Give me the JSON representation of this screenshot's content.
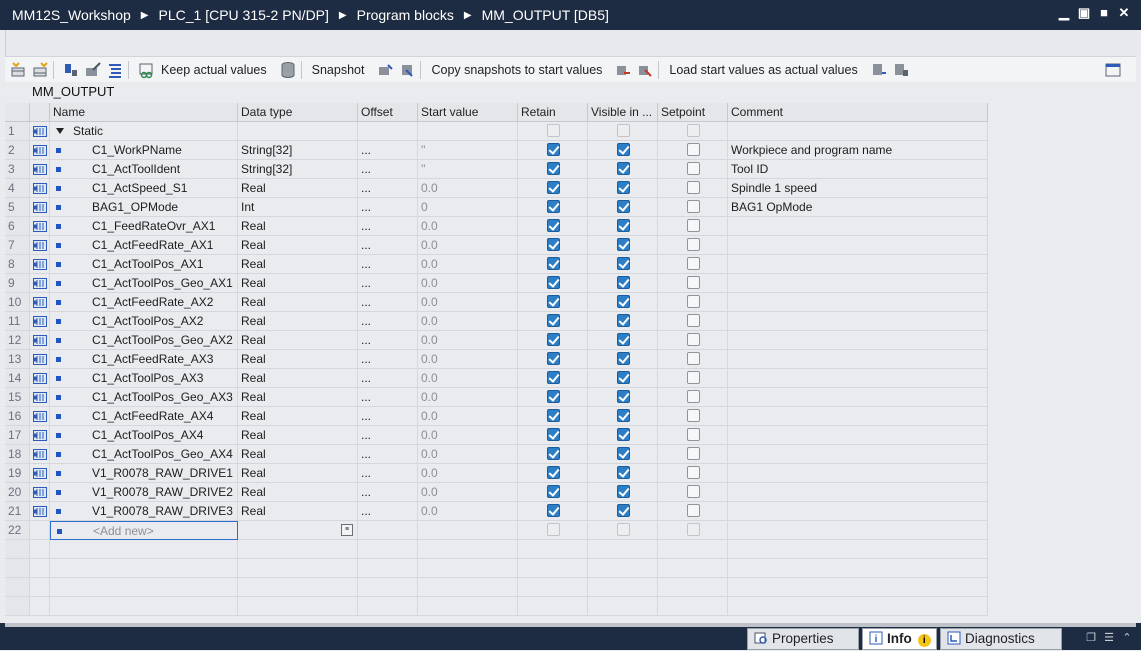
{
  "titlebar": {
    "crumbs": [
      "MM12S_Workshop",
      "PLC_1 [CPU 315-2 PN/DP]",
      "Program blocks",
      "MM_OUTPUT [DB5]"
    ]
  },
  "toolbar": {
    "keep_actual": "Keep actual values",
    "snapshot": "Snapshot",
    "copy_snapshots": "Copy snapshots to start values",
    "load_start": "Load start values as actual values"
  },
  "block": {
    "name": "MM_OUTPUT"
  },
  "columns": {
    "name": "Name",
    "data_type": "Data type",
    "offset": "Offset",
    "start_value": "Start value",
    "retain": "Retain",
    "visible": "Visible in ...",
    "setpoint": "Setpoint",
    "comment": "Comment"
  },
  "static_row": {
    "num": "1",
    "name": "Static"
  },
  "rows": [
    {
      "num": "2",
      "name": "C1_WorkPName",
      "type": "String[32]",
      "offset": "...",
      "start": "''",
      "comment": "Workpiece and program name"
    },
    {
      "num": "3",
      "name": "C1_ActToolIdent",
      "type": "String[32]",
      "offset": "...",
      "start": "''",
      "comment": "Tool ID"
    },
    {
      "num": "4",
      "name": "C1_ActSpeed_S1",
      "type": "Real",
      "offset": "...",
      "start": "0.0",
      "comment": "Spindle 1 speed"
    },
    {
      "num": "5",
      "name": "BAG1_OPMode",
      "type": "Int",
      "offset": "...",
      "start": "0",
      "comment": "BAG1 OpMode"
    },
    {
      "num": "6",
      "name": "C1_FeedRateOvr_AX1",
      "type": "Real",
      "offset": "...",
      "start": "0.0",
      "comment": ""
    },
    {
      "num": "7",
      "name": "C1_ActFeedRate_AX1",
      "type": "Real",
      "offset": "...",
      "start": "0.0",
      "comment": ""
    },
    {
      "num": "8",
      "name": "C1_ActToolPos_AX1",
      "type": "Real",
      "offset": "...",
      "start": "0.0",
      "comment": ""
    },
    {
      "num": "9",
      "name": "C1_ActToolPos_Geo_AX1",
      "type": "Real",
      "offset": "...",
      "start": "0.0",
      "comment": ""
    },
    {
      "num": "10",
      "name": "C1_ActFeedRate_AX2",
      "type": "Real",
      "offset": "...",
      "start": "0.0",
      "comment": ""
    },
    {
      "num": "11",
      "name": "C1_ActToolPos_AX2",
      "type": "Real",
      "offset": "...",
      "start": "0.0",
      "comment": ""
    },
    {
      "num": "12",
      "name": "C1_ActToolPos_Geo_AX2",
      "type": "Real",
      "offset": "...",
      "start": "0.0",
      "comment": ""
    },
    {
      "num": "13",
      "name": "C1_ActFeedRate_AX3",
      "type": "Real",
      "offset": "...",
      "start": "0.0",
      "comment": ""
    },
    {
      "num": "14",
      "name": "C1_ActToolPos_AX3",
      "type": "Real",
      "offset": "...",
      "start": "0.0",
      "comment": ""
    },
    {
      "num": "15",
      "name": "C1_ActToolPos_Geo_AX3",
      "type": "Real",
      "offset": "...",
      "start": "0.0",
      "comment": ""
    },
    {
      "num": "16",
      "name": "C1_ActFeedRate_AX4",
      "type": "Real",
      "offset": "...",
      "start": "0.0",
      "comment": ""
    },
    {
      "num": "17",
      "name": "C1_ActToolPos_AX4",
      "type": "Real",
      "offset": "...",
      "start": "0.0",
      "comment": ""
    },
    {
      "num": "18",
      "name": "C1_ActToolPos_Geo_AX4",
      "type": "Real",
      "offset": "...",
      "start": "0.0",
      "comment": ""
    },
    {
      "num": "19",
      "name": "V1_R0078_RAW_DRIVE1",
      "type": "Real",
      "offset": "...",
      "start": "0.0",
      "comment": ""
    },
    {
      "num": "20",
      "name": "V1_R0078_RAW_DRIVE2",
      "type": "Real",
      "offset": "...",
      "start": "0.0",
      "comment": ""
    },
    {
      "num": "21",
      "name": "V1_R0078_RAW_DRIVE3",
      "type": "Real",
      "offset": "...",
      "start": "0.0",
      "comment": ""
    }
  ],
  "add_row": {
    "num": "22",
    "placeholder": "<Add new>"
  },
  "bottom_tabs": {
    "properties": "Properties",
    "info": "Info",
    "diagnostics": "Diagnostics"
  },
  "colors": {
    "titlebar": "#1d2c42",
    "checkbox_checked": "#2c7fc7",
    "accent_blue": "#1f56c4"
  }
}
